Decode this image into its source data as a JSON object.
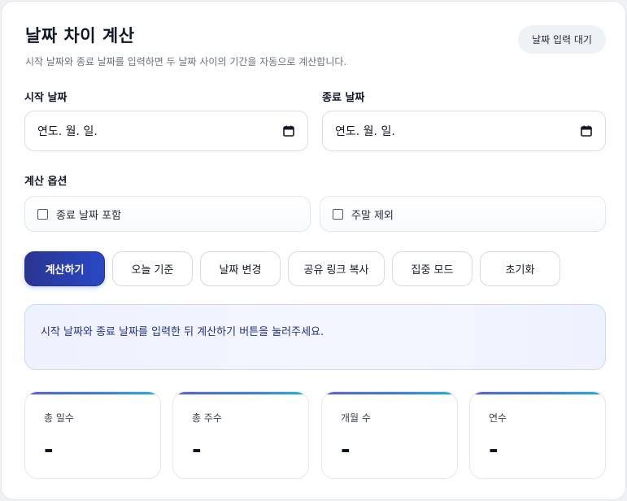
{
  "header": {
    "title": "날짜 차이 계산",
    "subtitle": "시작 날짜와 종료 날짜를 입력하면 두 날짜 사이의 기간을 자동으로 계산합니다.",
    "status_badge": "날짜 입력 대기"
  },
  "inputs": {
    "start": {
      "label": "시작 날짜",
      "value": "연도. 월. 일.",
      "icon": "calendar-icon"
    },
    "end": {
      "label": "종료 날짜",
      "value": "연도. 월. 일.",
      "icon": "calendar-icon"
    }
  },
  "options": {
    "label": "계산 옵션",
    "include_end": "종료 날짜 포함",
    "exclude_weekends": "주말 제외"
  },
  "buttons": {
    "calculate": "계산하기",
    "today": "오늘 기준",
    "swap": "날짜 변경",
    "share": "공유 링크 복사",
    "focus": "집중 모드",
    "reset": "초기화"
  },
  "message": "시작 날짜와 종료 날짜를 입력한 뒤 계산하기 버튼을 눌러주세요.",
  "stats": [
    {
      "label": "총 일수",
      "value": "-"
    },
    {
      "label": "총 주수",
      "value": "-"
    },
    {
      "label": "개월 수",
      "value": "-"
    },
    {
      "label": "연수",
      "value": "-"
    }
  ],
  "colors": {
    "primary": "#2a3592",
    "primary_end": "#2948c7",
    "message_text": "#23308a",
    "message_bg": "#eef2fe"
  }
}
